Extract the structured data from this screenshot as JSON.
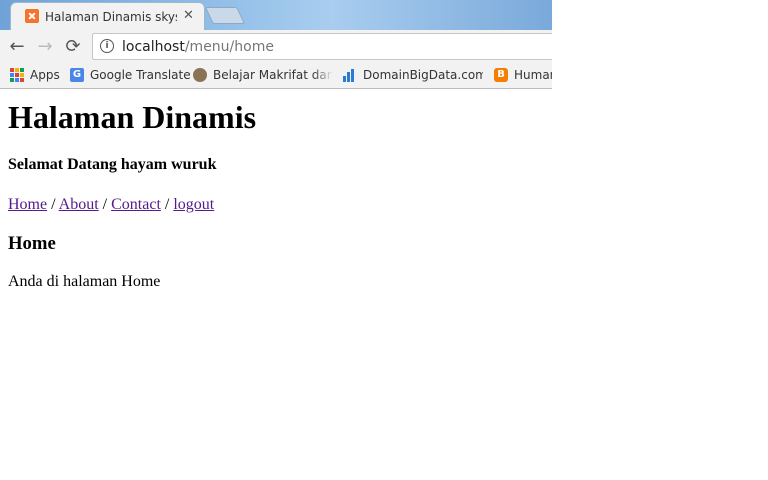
{
  "browser": {
    "tab": {
      "title": "Halaman Dinamis skyshi",
      "close": "✕"
    },
    "nav": {
      "back": "←",
      "forward": "→",
      "reload": "⟳"
    },
    "address": {
      "host": "localhost",
      "path": "/menu/home"
    },
    "bookmarks": [
      {
        "label": "Apps",
        "icon": "apps-grid-icon"
      },
      {
        "label": "Google Translate",
        "icon": "google-translate-icon"
      },
      {
        "label": "Belajar Makrifat dari J",
        "icon": "avatar-icon"
      },
      {
        "label": "DomainBigData.com -",
        "icon": "bar-chart-icon"
      },
      {
        "label": "Human",
        "icon": "blogger-icon"
      }
    ]
  },
  "page": {
    "title": "Halaman Dinamis",
    "welcome": "Selamat Datang hayam wuruk",
    "nav_links": [
      "Home",
      "About",
      "Contact",
      "logout"
    ],
    "nav_separator": " / ",
    "section_title": "Home",
    "content": "Anda di halaman Home"
  }
}
